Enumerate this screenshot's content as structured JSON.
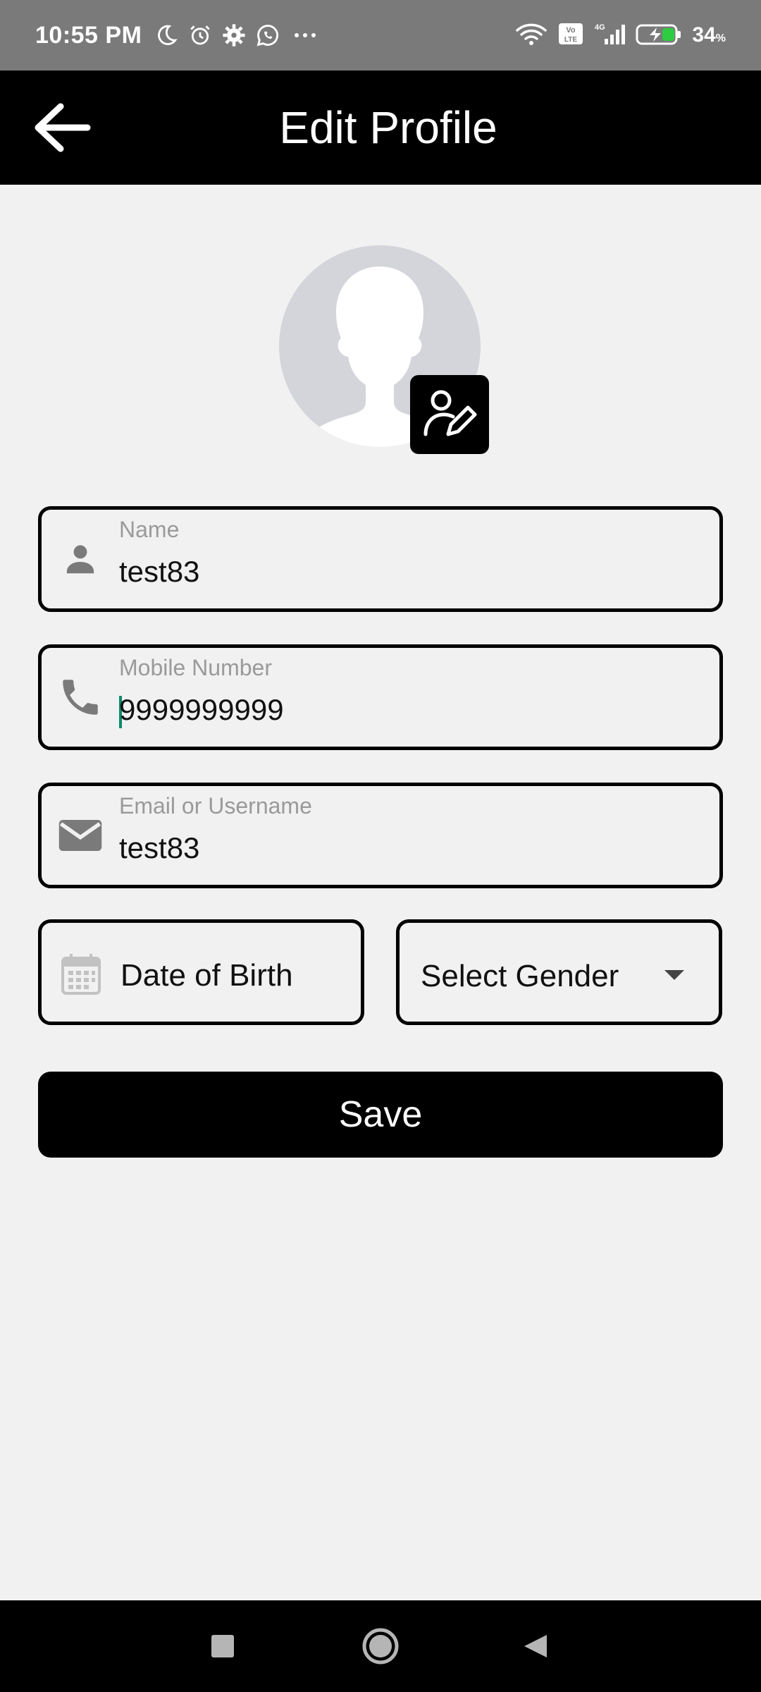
{
  "status_bar": {
    "time": "10:55 PM",
    "battery_level": "34",
    "battery_unit": "%",
    "left_icons": [
      "moon-icon",
      "alarm-icon",
      "gear-icon",
      "whatsapp-icon",
      "more-icon"
    ],
    "right_icons": [
      "wifi-icon",
      "volte-icon",
      "signal-icon",
      "battery-charging-icon"
    ],
    "network_label": "4G",
    "volte_label": "Vo LTE"
  },
  "app_bar": {
    "title": "Edit Profile",
    "back_icon": "arrow-left-icon"
  },
  "avatar": {
    "edit_icon": "user-edit-icon"
  },
  "form": {
    "name": {
      "label": "Name",
      "value": "test83",
      "icon": "person-icon"
    },
    "mobile": {
      "label": "Mobile Number",
      "value": "9999999999",
      "icon": "phone-icon"
    },
    "email": {
      "label": "Email or Username",
      "value": "test83",
      "icon": "mail-icon"
    },
    "dob": {
      "placeholder": "Date of Birth",
      "icon": "calendar-icon"
    },
    "gender": {
      "placeholder": "Select Gender",
      "icon": "dropdown-caret-icon"
    },
    "save_label": "Save"
  },
  "nav_bar": {
    "items": [
      "recents-square-icon",
      "home-circle-icon",
      "back-triangle-icon"
    ]
  },
  "colors": {
    "accent": "#000000",
    "background": "#f1f1f1",
    "status_bar": "#7a7a7a",
    "cursor": "#0d8a6e"
  }
}
